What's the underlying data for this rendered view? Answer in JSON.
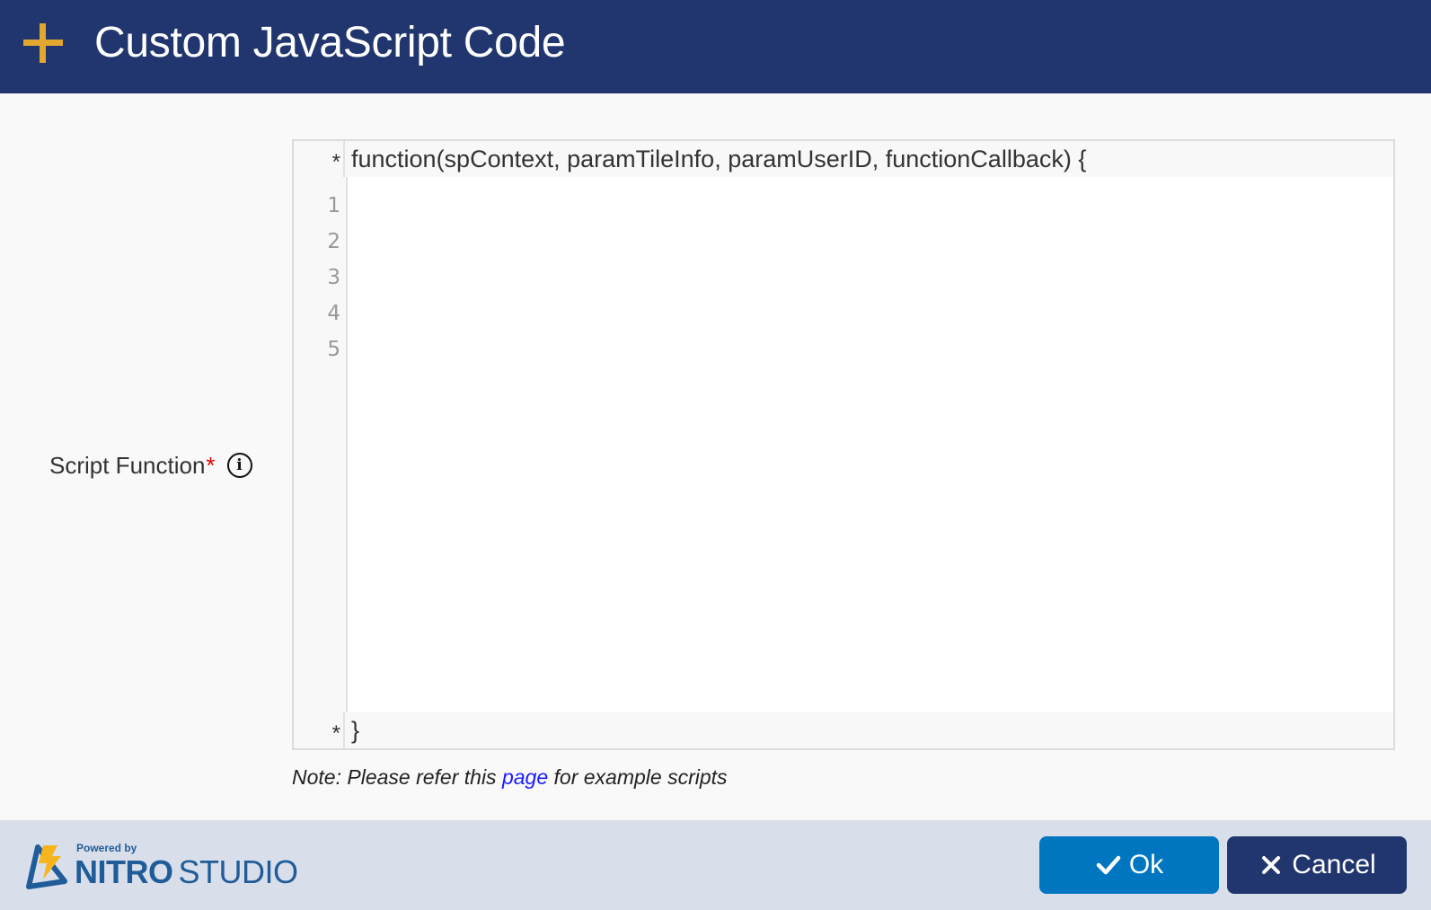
{
  "header": {
    "icon": "plus-icon",
    "title": "Custom JavaScript Code",
    "accent_color": "#e2a72e",
    "background_color": "#21366e"
  },
  "form": {
    "field_label": "Script Function",
    "required_marker": "*",
    "info_icon": "info-icon",
    "info_glyph": "i"
  },
  "editor": {
    "header_marker": "*",
    "header_code": "function(spContext, paramTileInfo, paramUserID, functionCallback) {",
    "footer_marker": "*",
    "footer_code": "}",
    "line_numbers": [
      "1",
      "2",
      "3",
      "4",
      "5"
    ],
    "value": ""
  },
  "note": {
    "prefix": "Note: Please refer this ",
    "link_text": "page",
    "suffix": " for example scripts"
  },
  "footer": {
    "logo_powered": "Powered by",
    "logo_brand_bold": "NITRO",
    "logo_brand_light": "STUDIO",
    "ok_label": "Ok",
    "ok_icon": "checkmark-icon",
    "cancel_label": "Cancel",
    "cancel_icon": "close-icon",
    "ok_color": "#0076c0",
    "cancel_color": "#21366e"
  }
}
